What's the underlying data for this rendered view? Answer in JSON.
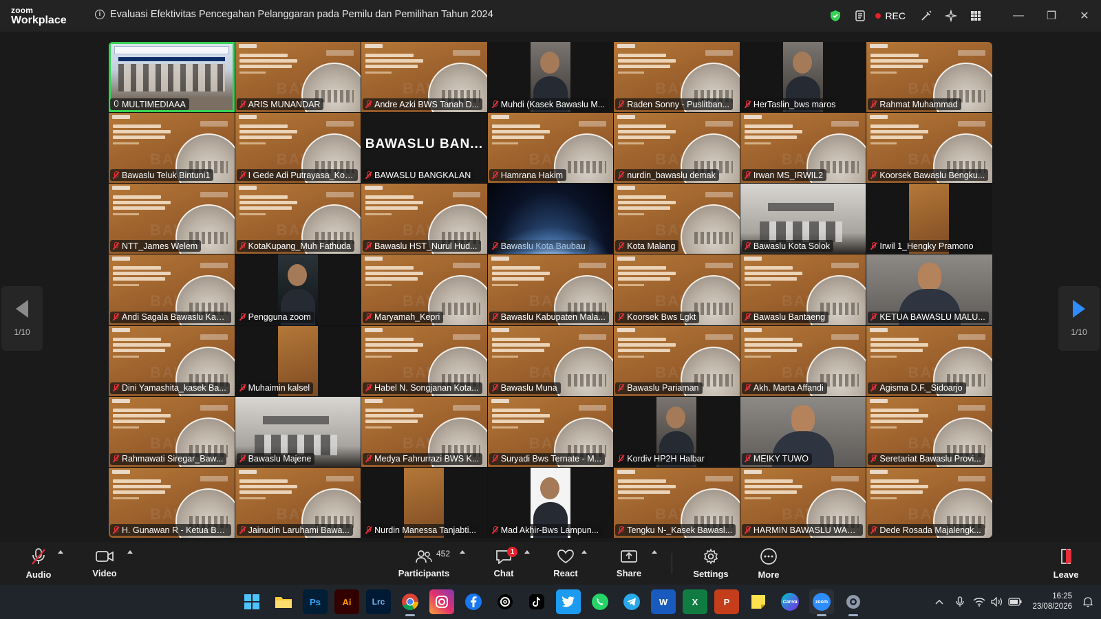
{
  "app": {
    "brand_line1": "zoom",
    "brand_line2": "Workplace"
  },
  "meeting": {
    "title": "Evaluasi Efektivitas Pencegahan Pelanggaran pada Pemilu dan Pemilihan Tahun 2024"
  },
  "titlebar": {
    "rec_label": "REC",
    "record_color": "#e5202b",
    "encryption_color": "#37d356"
  },
  "gallery": {
    "page_left": "1/10",
    "page_right": "1/10",
    "speaking_color": "#37d356",
    "tiles": [
      {
        "name": "MULTIMEDIAAA",
        "view": "conf",
        "mic": "on",
        "speaking": true
      },
      {
        "name": "ARIS MUNANDAR",
        "view": "slide",
        "mic": "off"
      },
      {
        "name": "Andre Azki BWS Tanah D...",
        "view": "slide",
        "mic": "off"
      },
      {
        "name": "Muhdi (Kasek Bawaslu M...",
        "view": "narrow-photo",
        "mic": "off"
      },
      {
        "name": "Raden Sonny - Puslitban...",
        "view": "slide",
        "mic": "off"
      },
      {
        "name": "HerTaslin_bws maros",
        "view": "narrow-photo",
        "mic": "off"
      },
      {
        "name": "Rahmat Muhammad",
        "view": "slide",
        "mic": "off"
      },
      {
        "name": "Bawaslu Teluk Bintuni1",
        "view": "slide",
        "mic": "off"
      },
      {
        "name": "I Gede Adi Putrayasa_Kor...",
        "view": "slide",
        "mic": "off"
      },
      {
        "name": "BAWASLU BANGKALAN",
        "view": "name-only",
        "big": "BAWASLU  BAN...",
        "mic": "off"
      },
      {
        "name": "Hamrana Hakim",
        "view": "slide",
        "mic": "off"
      },
      {
        "name": "nurdin_bawaslu demak",
        "view": "slide",
        "mic": "off"
      },
      {
        "name": "Irwan MS_IRWIL2",
        "view": "slide",
        "mic": "off"
      },
      {
        "name": "Koorsek Bawaslu Bengku...",
        "view": "slide",
        "mic": "off"
      },
      {
        "name": "NTT_James Welem",
        "view": "slide",
        "mic": "off"
      },
      {
        "name": "KotaKupang_Muh Fathuda",
        "view": "slide",
        "mic": "off"
      },
      {
        "name": "Bawaslu HST_Nurul Hud...",
        "view": "slide",
        "mic": "off"
      },
      {
        "name": "Bawaslu Kota Baubau",
        "view": "space",
        "mic": "off"
      },
      {
        "name": "Kota Malang",
        "view": "slide",
        "mic": "off"
      },
      {
        "name": "Bawaslu Kota Solok",
        "view": "room",
        "mic": "off"
      },
      {
        "name": "Irwil 1_Hengky Pramono",
        "view": "narrow-slide",
        "mic": "off"
      },
      {
        "name": "Andi Sagala Bawaslu Kab...",
        "view": "slide",
        "mic": "off"
      },
      {
        "name": "Pengguna zoom",
        "view": "narrow-dark",
        "mic": "off"
      },
      {
        "name": "Maryamah_Kepri",
        "view": "slide",
        "mic": "off"
      },
      {
        "name": "Bawaslu Kabupaten Mala...",
        "view": "slide",
        "mic": "off"
      },
      {
        "name": "Koorsek Bws Lgkt",
        "view": "slide",
        "mic": "off"
      },
      {
        "name": "Bawaslu Bantaeng",
        "view": "slide",
        "mic": "off"
      },
      {
        "name": "KETUA BAWASLU MALU...",
        "view": "camera",
        "mic": "off"
      },
      {
        "name": "Dini Yamashita_kasek Ba...",
        "view": "slide",
        "mic": "off"
      },
      {
        "name": "Muhaimin kalsel",
        "view": "narrow-slide",
        "mic": "off"
      },
      {
        "name": "Habel N. Songjanan Kota...",
        "view": "slide",
        "mic": "off"
      },
      {
        "name": "Bawaslu Muna",
        "view": "slide",
        "mic": "off"
      },
      {
        "name": "Bawaslu Pariaman",
        "view": "slide",
        "mic": "off"
      },
      {
        "name": "Akh. Marta Affandi",
        "view": "slide",
        "mic": "off"
      },
      {
        "name": "Agisma D.F._Sidoarjo",
        "view": "slide",
        "mic": "off"
      },
      {
        "name": "Rahmawati Siregar_Baw...",
        "view": "slide",
        "mic": "off"
      },
      {
        "name": "Bawaslu Majene",
        "view": "room",
        "mic": "off"
      },
      {
        "name": "Medya Fahrurrazi BWS K...",
        "view": "slide",
        "mic": "off"
      },
      {
        "name": "Suryadi Bws Ternate - M...",
        "view": "slide",
        "mic": "off"
      },
      {
        "name": "Kordiv HP2H Halbar",
        "view": "narrow-photo",
        "mic": "off"
      },
      {
        "name": "MEIKY TUWO",
        "view": "camera",
        "mic": "off"
      },
      {
        "name": "Seretariat Bawaslu Provi...",
        "view": "slide",
        "mic": "off"
      },
      {
        "name": "H. Gunawan R - Ketua Ba...",
        "view": "slide",
        "mic": "off"
      },
      {
        "name": "Jainudin Laruhami Bawa...",
        "view": "slide",
        "mic": "off"
      },
      {
        "name": "Nurdin Manessa Tanjabti...",
        "view": "narrow-slide",
        "mic": "off"
      },
      {
        "name": "Mad Akhir-Bws Lampun...",
        "view": "narrow-white",
        "mic": "off"
      },
      {
        "name": "Tengku N-_Kasek Bawasl...",
        "view": "slide",
        "mic": "off"
      },
      {
        "name": "HARMIN BAWASLU WAK...",
        "view": "slide",
        "mic": "off"
      },
      {
        "name": "Dede Rosada Majalengk...",
        "view": "slide",
        "mic": "off"
      }
    ]
  },
  "toolbar": {
    "audio": "Audio",
    "video": "Video",
    "participants": "Participants",
    "participants_count": "452",
    "chat": "Chat",
    "chat_badge": "1",
    "react": "React",
    "share": "Share",
    "settings": "Settings",
    "more": "More",
    "leave": "Leave"
  },
  "taskbar": {
    "apps": [
      "start-icon",
      "file-explorer-icon",
      "photoshop-icon",
      "illustrator-icon",
      "lightroom-icon",
      "chrome-icon",
      "instagram-icon",
      "facebook-icon",
      "threads-icon",
      "tiktok-icon",
      "twitter-icon",
      "whatsapp-icon",
      "telegram-icon",
      "word-icon",
      "excel-icon",
      "powerpoint-icon",
      "sticky-notes-icon",
      "canva-icon",
      "zoom-icon",
      "settings-icon"
    ],
    "labels": {
      "ps": "Ps",
      "ai": "Ai",
      "lrc": "Lrc",
      "w": "W",
      "x": "X",
      "p": "P",
      "canva": "Canva",
      "zoom": "zoom"
    },
    "time": "16:25",
    "date": "23/08/2026"
  }
}
